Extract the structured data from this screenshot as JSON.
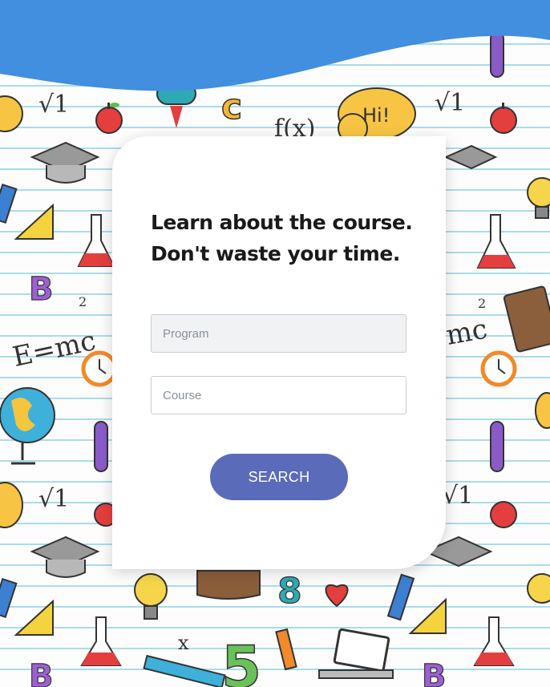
{
  "page": {
    "headline_line1": "Learn about the course.",
    "headline_line2": "Don't waste your time."
  },
  "form": {
    "program_placeholder": "Program",
    "program_value": "",
    "course_placeholder": "Course",
    "course_value": "",
    "search_label": "SEARCH"
  },
  "doodles": {
    "sqrt_label": "√1",
    "fx_label": "f(x)",
    "hi_label": "Hi!",
    "emc_label": "E=mc",
    "emc_right_label": "mc",
    "b_label": "B",
    "five_label": "5",
    "eight_label": "8",
    "two_label": "2",
    "x_label": "x"
  },
  "colors": {
    "header_blue": "#418fde",
    "button": "#5a6bba",
    "line_blue": "#a9dceb"
  }
}
